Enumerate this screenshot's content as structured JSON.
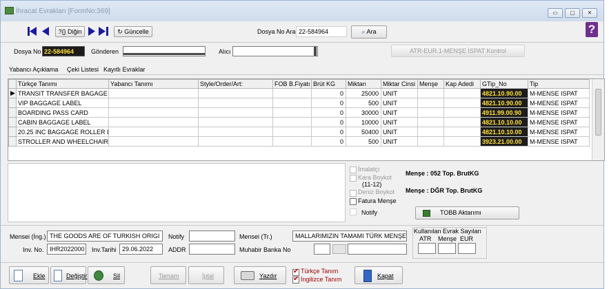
{
  "window": {
    "title": "İhracat Evrakları [FormNo:369]"
  },
  "toolbar": {
    "digin_label": "?{} Diğin",
    "guncelle_label": "Güncelle",
    "dosya_no_ara_label": "Dosya No Ara",
    "dosya_no_ara_value": "22-584964",
    "ara_label": "Ara",
    "help_label": "?"
  },
  "header": {
    "dosya_no_label": "Dosya No",
    "dosya_no_value": "22-584964",
    "gonderen_label": "Gönderen",
    "alici_label": "Alıcı",
    "atr_button_label": "ATR-EUR.1-MENŞE İSPAT Kontrol"
  },
  "tabs": [
    "Yabancı Açıklama",
    "Çeki Listesi",
    "Kayıtlı Evraklar"
  ],
  "grid": {
    "columns": [
      "Türkçe Tanımı",
      "Yabancı Tanımı",
      "Style/Order/Art:",
      "FOB B.Fiyatı",
      "Brüt KG",
      "Miktarı",
      "Miktar Cinsi",
      "Menşe",
      "Kap Adedi",
      "GTip_No",
      "Tip"
    ],
    "rows": [
      {
        "indicator": "▶",
        "turkce": "TRANSIT TRANSFER BAGAGE",
        "yabanci": "",
        "style": "",
        "fob": "",
        "brut": "0",
        "miktar": "25000",
        "cinsi": "UNIT",
        "mense": "",
        "kap": "",
        "gtip": "4821.10.90.00",
        "tip": "M-MENSE ISPAT"
      },
      {
        "indicator": "",
        "turkce": "VIP BAGGAGE LABEL",
        "yabanci": "",
        "style": "",
        "fob": "",
        "brut": "0",
        "miktar": "500",
        "cinsi": "UNIT",
        "mense": "",
        "kap": "",
        "gtip": "4821.10.90.00",
        "tip": "M-MENSE ISPAT"
      },
      {
        "indicator": "",
        "turkce": "BOARDING PASS CARD",
        "yabanci": "",
        "style": "",
        "fob": "",
        "brut": "0",
        "miktar": "30000",
        "cinsi": "UNIT",
        "mense": "",
        "kap": "",
        "gtip": "4911.99.00.90",
        "tip": "M-MENSE ISPAT"
      },
      {
        "indicator": "",
        "turkce": "CABIN BAGGAGE LABEL",
        "yabanci": "",
        "style": "",
        "fob": "",
        "brut": "0",
        "miktar": "10000",
        "cinsi": "UNIT",
        "mense": "",
        "kap": "",
        "gtip": "4821.10.10.00",
        "tip": "M-MENSE ISPAT"
      },
      {
        "indicator": "",
        "turkce": "20.25 INC BAGGAGE ROLLER L",
        "yabanci": "",
        "style": "",
        "fob": "",
        "brut": "0",
        "miktar": "50400",
        "cinsi": "UNIT",
        "mense": "",
        "kap": "",
        "gtip": "4821.10.10.00",
        "tip": "M-MENSE ISPAT"
      },
      {
        "indicator": "",
        "turkce": "STROLLER AND WHEELCHAIR",
        "yabanci": "",
        "style": "",
        "fob": "",
        "brut": "0",
        "miktar": "500",
        "cinsi": "UNIT",
        "mense": "",
        "kap": "",
        "gtip": "3923.21.00.00",
        "tip": "M-MENSE ISPAT"
      }
    ]
  },
  "options": {
    "imalatci": "İmalatçı",
    "kara_boykot": "Kara Boykot",
    "boykot_code": "(11-12)",
    "deniz_boykot": "Deniz Boykot",
    "fatura_mense": "Fatura Menşe",
    "notify": "Notify",
    "mense_052": "Menşe : 052  Top. BrutKG",
    "mense_dgr": "Menşe : DĞR  Top. BrutKG",
    "tobb_label": "TOBB Aktarımı"
  },
  "footer": {
    "mensei_ing_label": "Mensei (İng.)",
    "mensei_ing_value": "THE GOODS ARE OF TURKISH ORIGI",
    "notify_label": "Notify",
    "mensei_tr_label": "Mensei (Tr.)",
    "mensei_tr_value": "MALLARIMIZIN TAMAMI TÜRK MENŞE",
    "kullanilan_label": "Kullanılan Evrak Sayıları",
    "atr_label": "ATR",
    "mense_label": "Menşe",
    "eur_label": "EUR",
    "inv_no_label": "Inv. No.",
    "inv_no_value": "IHR2022000",
    "inv_tarihi_label": "Inv.Tarihi",
    "inv_tarihi_value": "29.06.2022",
    "addr_label": "ADDR",
    "muhabir_label": "Muhabir Banka No"
  },
  "bottom": {
    "ekle": "Ekle",
    "degistir": "Değiştir",
    "sil": "Sil",
    "tamam": "Tamam",
    "iptal": "İptal",
    "yazdir": "Yazdır",
    "turkce_tanim": "Türkçe Tanım",
    "ingilizce_tanim": "İngilizce Tanım",
    "kapat": "Kapat"
  }
}
